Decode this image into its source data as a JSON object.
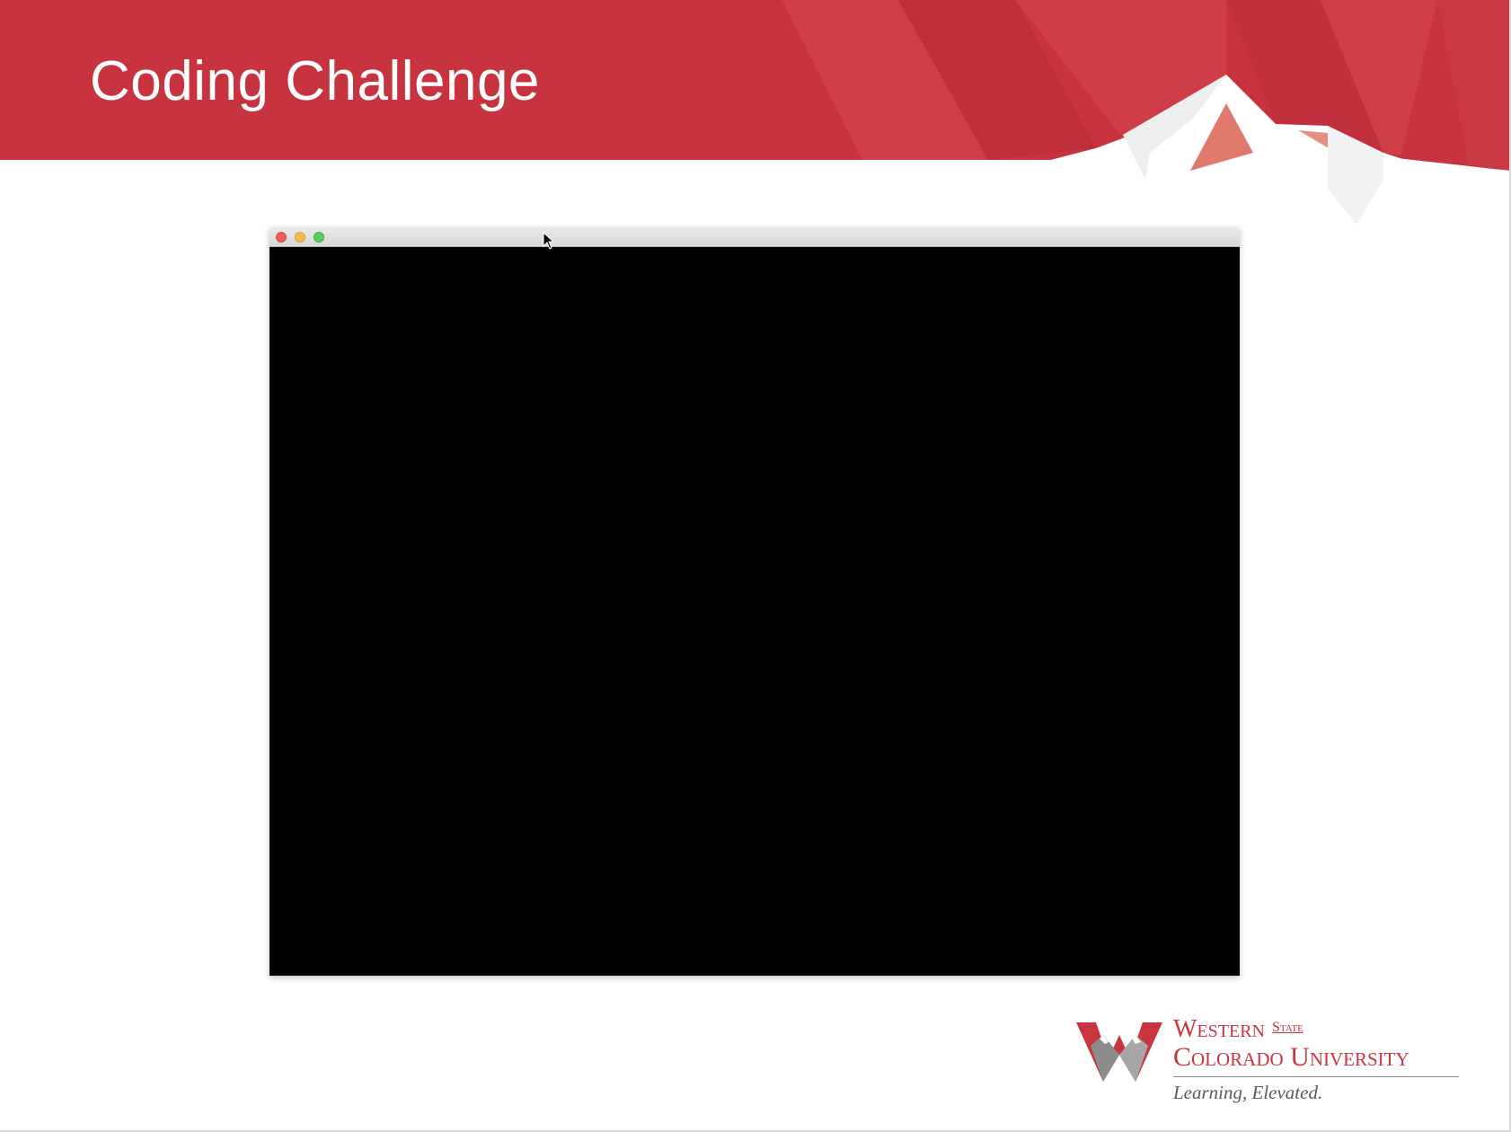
{
  "slide": {
    "title": "Coding Challenge"
  },
  "window": {
    "controls": [
      "close",
      "minimize",
      "zoom"
    ],
    "content": "blank black canvas"
  },
  "logo": {
    "line1": "Western",
    "line1_small": "State",
    "line2": "Colorado University",
    "tagline": "Learning, Elevated."
  },
  "colors": {
    "brand_red": "#c8343f",
    "banner_red": "#c73440",
    "canvas": "#000000"
  },
  "icons": [
    "mountain-peak-icon",
    "w-mountain-logo-icon",
    "mouse-cursor-icon"
  ]
}
